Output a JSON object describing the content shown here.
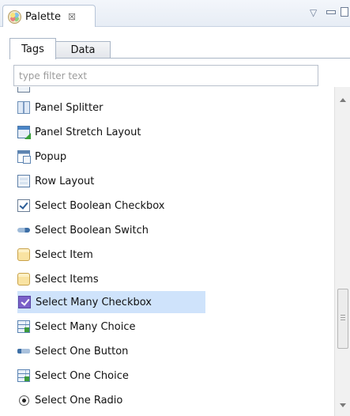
{
  "view": {
    "title": "Palette",
    "close_glyph": "☒",
    "menu_glyph": "▽"
  },
  "tabs": [
    {
      "label": "Tags",
      "active": true
    },
    {
      "label": "Data",
      "active": false
    }
  ],
  "filter": {
    "placeholder": "type filter text",
    "value": ""
  },
  "items": [
    {
      "label": "",
      "icon": "cut-icon",
      "selected": false
    },
    {
      "label": "Panel Splitter",
      "icon": "panel-splitter-icon",
      "selected": false
    },
    {
      "label": "Panel Stretch Layout",
      "icon": "panel-stretch-layout-icon",
      "selected": false
    },
    {
      "label": "Popup",
      "icon": "popup-icon",
      "selected": false
    },
    {
      "label": "Row Layout",
      "icon": "row-layout-icon",
      "selected": false
    },
    {
      "label": "Select Boolean Checkbox",
      "icon": "checkbox-icon",
      "selected": false
    },
    {
      "label": "Select Boolean Switch",
      "icon": "switch-icon",
      "selected": false
    },
    {
      "label": "Select Item",
      "icon": "select-item-icon",
      "selected": false
    },
    {
      "label": "Select Items",
      "icon": "select-items-icon",
      "selected": false
    },
    {
      "label": "Select Many Checkbox",
      "icon": "many-checkbox-icon",
      "selected": true
    },
    {
      "label": "Select Many Choice",
      "icon": "many-choice-icon",
      "selected": false
    },
    {
      "label": "Select One Button",
      "icon": "one-button-icon",
      "selected": false
    },
    {
      "label": "Select One Choice",
      "icon": "one-choice-icon",
      "selected": false
    },
    {
      "label": "Select One Radio",
      "icon": "radio-icon",
      "selected": false
    }
  ],
  "colors": {
    "selection": "#cfe3fb",
    "tab_border": "#a9b5c6"
  }
}
